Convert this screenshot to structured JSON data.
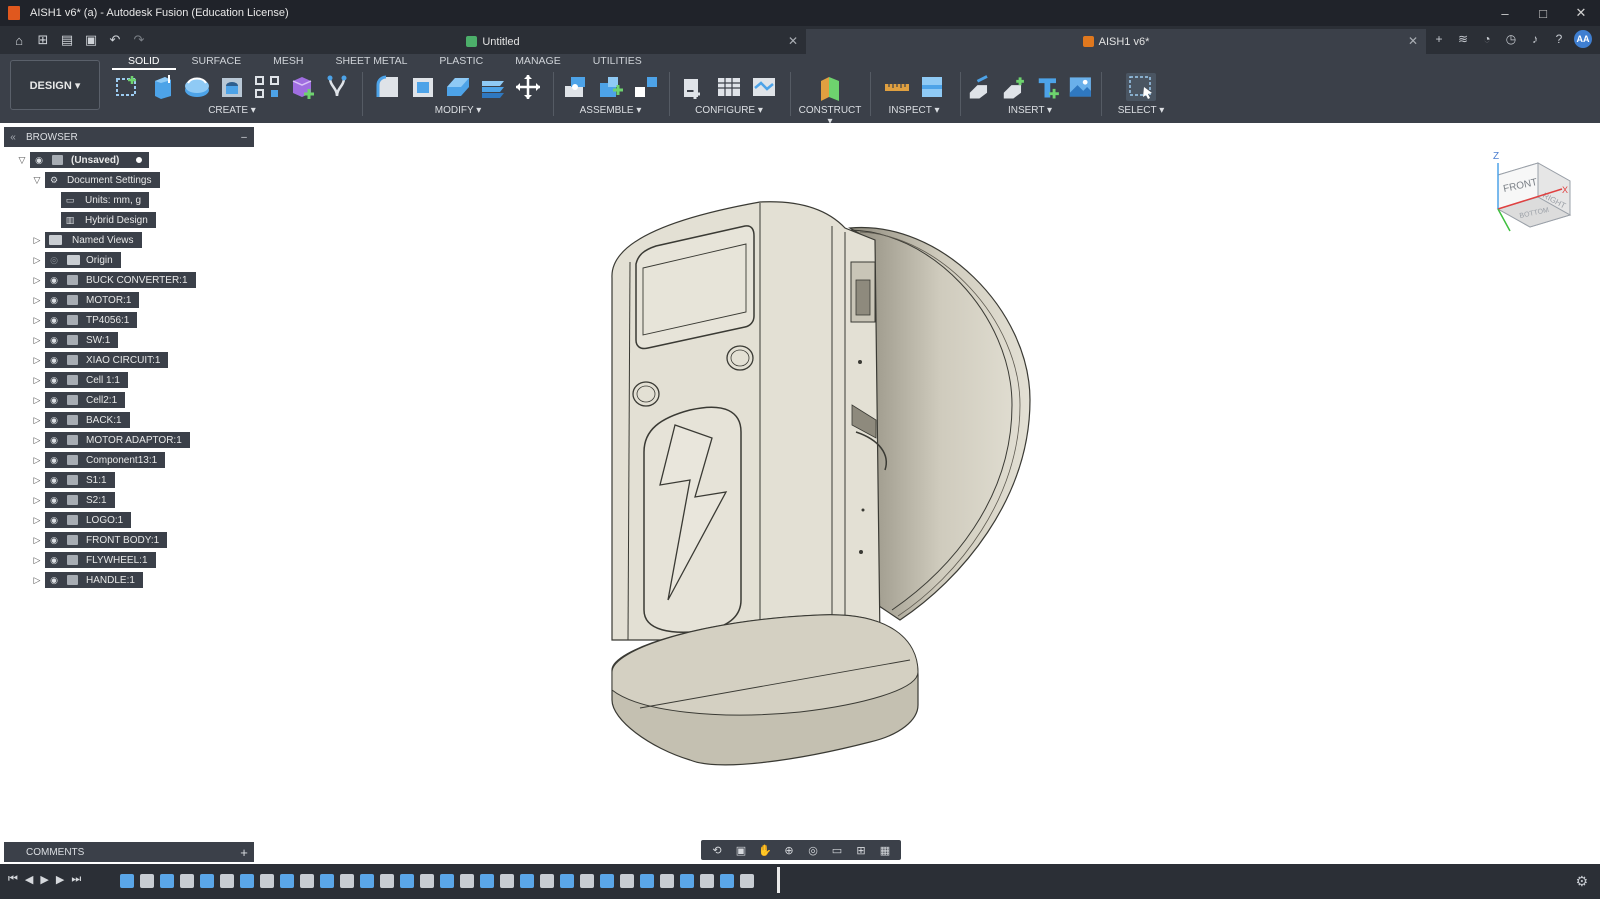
{
  "window": {
    "title": "AISH1 v6* (a) - Autodesk Fusion (Education License)",
    "controls": [
      "–",
      "□",
      "✕"
    ]
  },
  "doc_tabs": [
    {
      "label": "Untitled",
      "active": false
    },
    {
      "label": "AISH1 v6*",
      "active": true
    }
  ],
  "account": {
    "initials": "AA"
  },
  "ribbon": {
    "workspace": "DESIGN ▾",
    "tabs": [
      "SOLID",
      "SURFACE",
      "MESH",
      "SHEET METAL",
      "PLASTIC",
      "MANAGE",
      "UTILITIES"
    ],
    "groups": {
      "create": "CREATE ▾",
      "modify": "MODIFY ▾",
      "assemble": "ASSEMBLE ▾",
      "configure": "CONFIGURE ▾",
      "construct": "CONSTRUCT ▾",
      "inspect": "INSPECT ▾",
      "insert": "INSERT ▾",
      "select": "SELECT ▾"
    }
  },
  "browser": {
    "title": "BROWSER",
    "root": "(Unsaved)",
    "document_settings": "Document Settings",
    "units": "Units: mm, g",
    "hybrid": "Hybrid Design",
    "named_views": "Named Views",
    "origin": "Origin",
    "components": [
      "BUCK CONVERTER:1",
      "MOTOR:1",
      "TP4056:1",
      "SW:1",
      "XIAO CIRCUIT:1",
      "Cell 1:1",
      "Cell2:1",
      "BACK:1",
      "MOTOR ADAPTOR:1",
      "Component13:1",
      "S1:1",
      "S2:1",
      "LOGO:1",
      "FRONT BODY:1",
      "FLYWHEEL:1",
      "HANDLE:1"
    ]
  },
  "comments": {
    "title": "COMMENTS"
  },
  "viewcube": {
    "front": "FRONT",
    "right": "RIGHT",
    "bottom": "BOTTOM",
    "axis_z": "Z",
    "axis_x": "X"
  },
  "colors": {
    "ui_dark": "#3b4049",
    "accent": "#3f7fd1",
    "model": "#e3e0d4",
    "model_shade": "#b9b5a6"
  }
}
